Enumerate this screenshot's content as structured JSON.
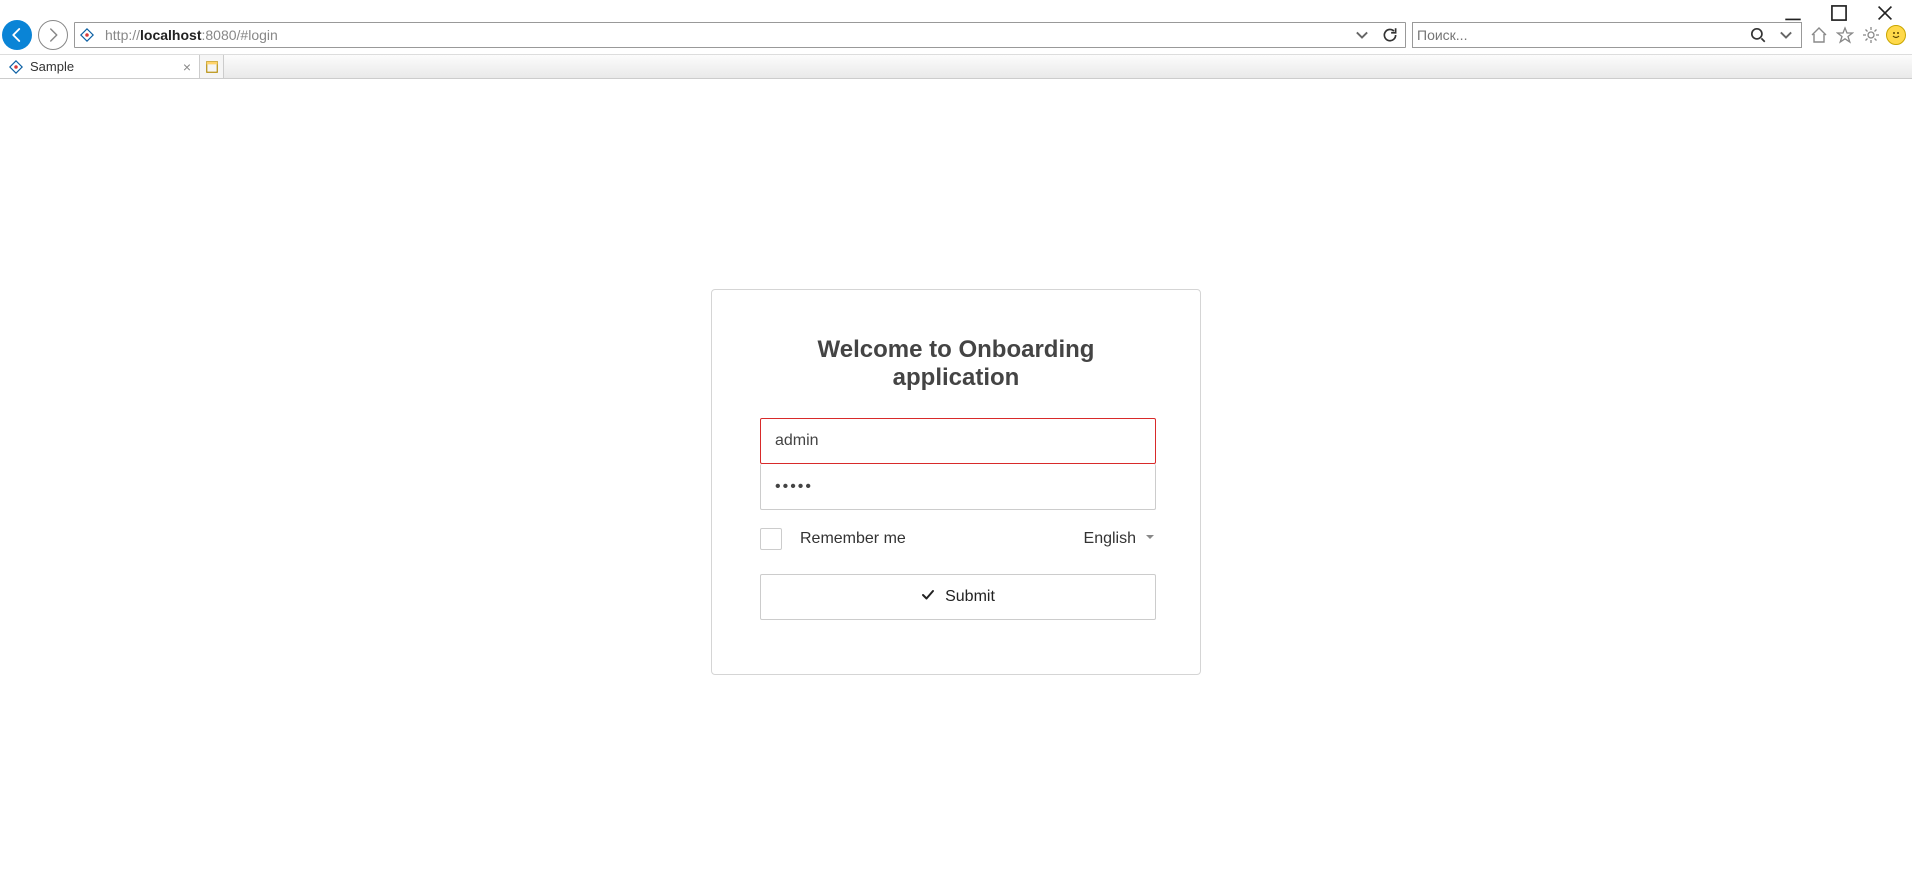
{
  "browser": {
    "url_proto": "http://",
    "url_host": "localhost",
    "url_rest": ":8080/#login",
    "search_placeholder": "Поиск...",
    "tab_title": "Sample"
  },
  "login": {
    "title": "Welcome to Onboarding application",
    "username_value": "admin",
    "password_value": "•••••",
    "remember_label": "Remember me",
    "remember_checked": false,
    "language_value": "English",
    "submit_label": "Submit"
  }
}
